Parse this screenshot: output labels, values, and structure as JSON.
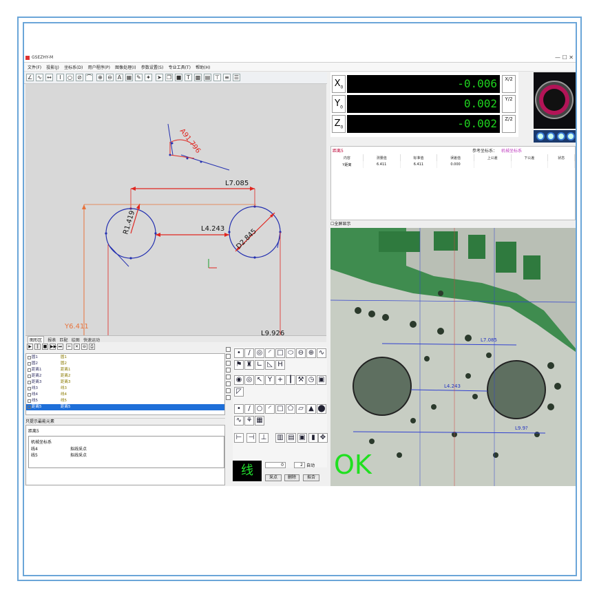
{
  "window": {
    "title": "GSEZHY-M"
  },
  "menu": [
    "文件(F)",
    "投影(J)",
    "坐标系(D)",
    "用户程序(P)",
    "图像处理(I)",
    "参数设置(S)",
    "专业工具(T)",
    "帮助(H)"
  ],
  "canvas": {
    "angle_label": "A91.796",
    "l7": "L7.085",
    "l4": "L4.243",
    "r1": "R1.419",
    "d2": "D2.845",
    "y6": "Y6.411",
    "l9": "L9.926"
  },
  "panel_tabs": [
    "图形区",
    "报表",
    "匹配",
    "绘图",
    "快速运动"
  ],
  "element_list": [
    {
      "a": "圆1",
      "b": "圆1"
    },
    {
      "a": "圆2",
      "b": "圆2"
    },
    {
      "a": "距离1",
      "b": "距离1"
    },
    {
      "a": "距离2",
      "b": "距离2"
    },
    {
      "a": "距离3",
      "b": "距离3"
    },
    {
      "a": "线3",
      "b": "线3"
    },
    {
      "a": "线4",
      "b": "线4"
    },
    {
      "a": "线5",
      "b": "线5"
    },
    {
      "a": "距离5",
      "b": "距离5"
    }
  ],
  "calc": {
    "checkbox_label": "只提示最能元素",
    "header": "距离5",
    "coord": "机械坐标系",
    "rows": [
      {
        "k": "线4",
        "v": "拟线采点"
      },
      {
        "k": "线5",
        "v": "拟线采点"
      }
    ]
  },
  "line_tool": {
    "label": "线",
    "input_a": "0",
    "input_b": "2",
    "auto_label": "自动",
    "btn1": "采点",
    "btn2": "删除",
    "btn3": "拟合"
  },
  "dro": {
    "x": {
      "label": "X",
      "sub": "0",
      "value": "-0.006"
    },
    "y": {
      "label": "Y",
      "sub": "0",
      "value": "0.002"
    },
    "z": {
      "label": "Z",
      "sub": "0",
      "value": "-0.002"
    },
    "half_label": "X/2",
    "half_label_y": "Y/2",
    "half_label_z": "Z/2"
  },
  "result": {
    "title": "距离5",
    "ref_label": "参考坐标系：",
    "ref_value": "机械坐标系",
    "columns": [
      "内容",
      "测量值",
      "标准值",
      "误差值",
      "上公差",
      "下公差",
      "状态"
    ],
    "rows": [
      [
        "Y距离",
        "6.411",
        "6.411",
        "0.000",
        "",
        "",
        ""
      ]
    ]
  },
  "video": {
    "header": "☐全屏显示",
    "ok": "OK",
    "l7": "L7.085",
    "l4": "L4.243",
    "l9": "L9.9?"
  },
  "colors": {
    "dro_green": "#1ed21e",
    "dim_red": "#e0251f",
    "geom_blue": "#2430b0",
    "orange": "#e8723a",
    "ok_green": "#1fe01f",
    "selection": "#1e6fd9"
  }
}
